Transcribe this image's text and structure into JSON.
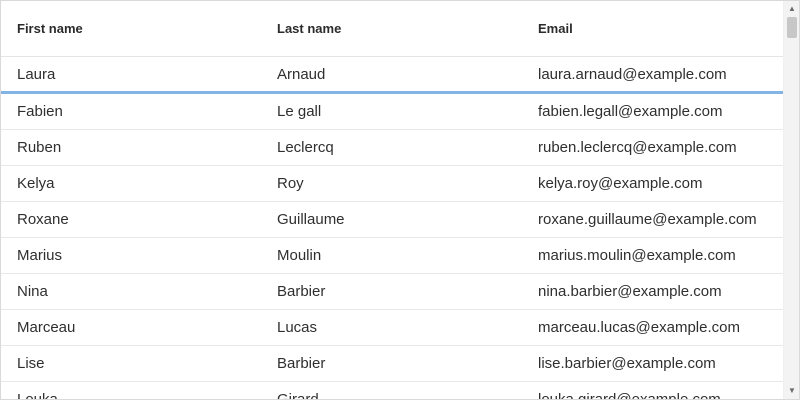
{
  "columns": [
    {
      "label": "First name",
      "key": "first"
    },
    {
      "label": "Last name",
      "key": "last"
    },
    {
      "label": "Email",
      "key": "email"
    }
  ],
  "rows": [
    {
      "first": "Laura",
      "last": "Arnaud",
      "email": "laura.arnaud@example.com",
      "drop_target": true
    },
    {
      "first": "Fabien",
      "last": "Le gall",
      "email": "fabien.legall@example.com"
    },
    {
      "first": "Ruben",
      "last": "Leclercq",
      "email": "ruben.leclercq@example.com"
    },
    {
      "first": "Kelya",
      "last": "Roy",
      "email": "kelya.roy@example.com"
    },
    {
      "first": "Roxane",
      "last": "Guillaume",
      "email": "roxane.guillaume@example.com"
    },
    {
      "first": "Marius",
      "last": "Moulin",
      "email": "marius.moulin@example.com"
    },
    {
      "first": "Nina",
      "last": "Barbier",
      "email": "nina.barbier@example.com"
    },
    {
      "first": "Marceau",
      "last": "Lucas",
      "email": "marceau.lucas@example.com"
    },
    {
      "first": "Lise",
      "last": "Barbier",
      "email": "lise.barbier@example.com"
    },
    {
      "first": "Louka",
      "last": "Girard",
      "email": "louka.girard@example.com"
    }
  ],
  "scrollbar": {
    "up_icon": "arrow-up-icon",
    "down_icon": "arrow-down-icon"
  },
  "colors": {
    "drop_indicator": "#82b4e6",
    "border": "#e8e8e8",
    "scroll_thumb": "#c7c7c7"
  }
}
